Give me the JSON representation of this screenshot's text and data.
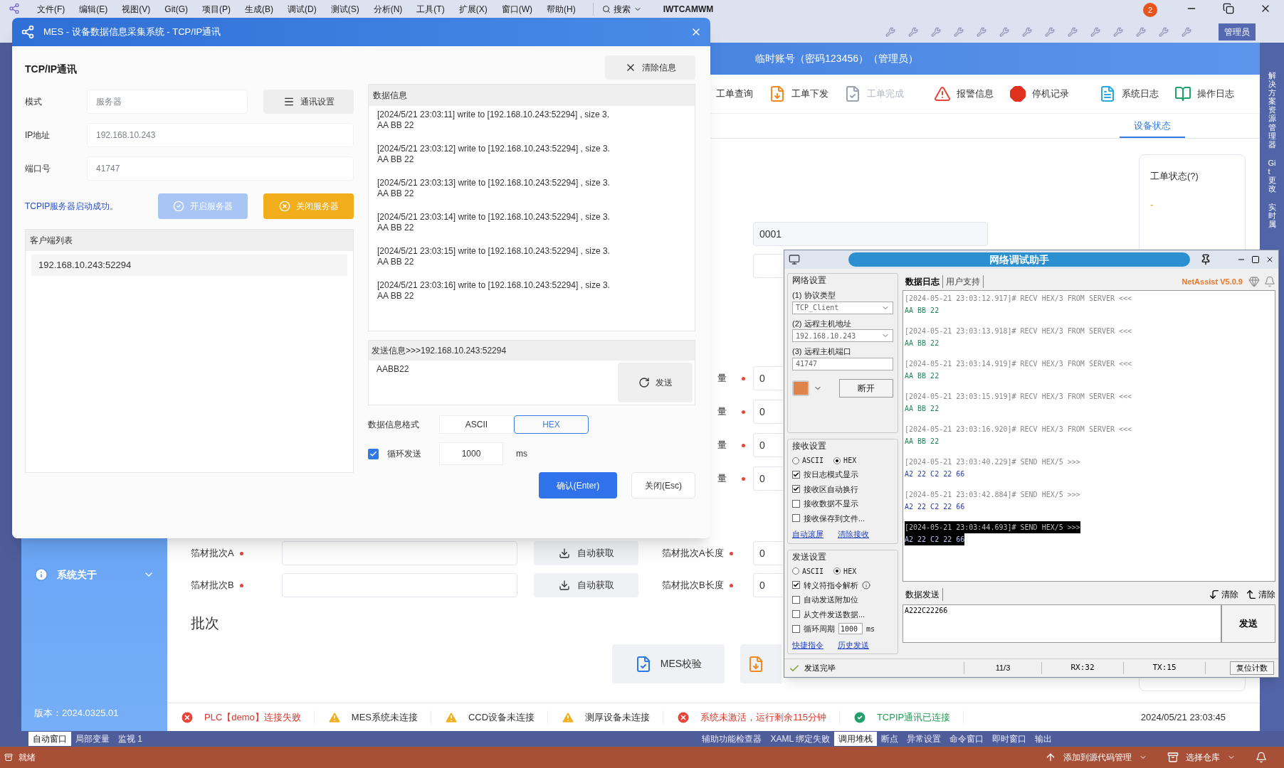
{
  "ide": {
    "menu": [
      "文件(F)",
      "编辑(E)",
      "视图(V)",
      "Git(G)",
      "项目(P)",
      "生成(B)",
      "调试(D)",
      "测试(S)",
      "分析(N)",
      "工具(T)",
      "扩展(X)",
      "窗口(W)",
      "帮助(H)"
    ],
    "search": "搜索",
    "project": "IWTCAMWM",
    "notifications": "2",
    "account": "管理员",
    "side_tabs": [
      "解决方案资源管理器",
      "Git 更改",
      "实时属"
    ],
    "bottom_tabs_left": [
      {
        "label": "自动窗口",
        "selected": true
      },
      {
        "label": "局部变量",
        "selected": false
      },
      {
        "label": "监视 1",
        "selected": false
      }
    ],
    "bottom_tabs_right": [
      {
        "label": "辅助功能检查器",
        "selected": false
      },
      {
        "label": "XAML 绑定失败",
        "selected": false
      },
      {
        "label": "调用堆栈",
        "selected": true
      },
      {
        "label": "断点",
        "selected": false
      },
      {
        "label": "异常设置",
        "selected": false
      },
      {
        "label": "命令窗口",
        "selected": false
      },
      {
        "label": "即时窗口",
        "selected": false
      },
      {
        "label": "输出",
        "selected": false
      }
    ],
    "status": "就绪",
    "status_right": [
      "添加到源代码管理",
      "选择仓库"
    ]
  },
  "app": {
    "user": "临时账号（密码123456）（管理员）",
    "toolbar": [
      {
        "label": "工单查询",
        "kind": "query",
        "disabled": false
      },
      {
        "label": "工单下发",
        "kind": "dispatch",
        "disabled": false
      },
      {
        "label": "工单完成",
        "kind": "complete",
        "disabled": true
      },
      {
        "label": "报警信息",
        "kind": "alarm",
        "disabled": false
      },
      {
        "label": "停机记录",
        "kind": "stop",
        "disabled": false
      },
      {
        "label": "系统日志",
        "kind": "syslog",
        "disabled": false
      },
      {
        "label": "操作日志",
        "kind": "oplog",
        "disabled": false
      }
    ],
    "tabs": [
      {
        "label": "设备状态",
        "selected": true
      }
    ],
    "sidebar": [
      {
        "label": "系统关于"
      }
    ],
    "version": "版本：2024.0325.01",
    "order_value": "0001",
    "measure_rows": [
      {
        "label": "量",
        "value": "0"
      },
      {
        "label": "量",
        "value": "0"
      },
      {
        "label": "量",
        "value": "0"
      },
      {
        "label": "量",
        "value": "0"
      }
    ],
    "batch_rows": [
      {
        "label": "箔材批次A",
        "button": "自动获取",
        "length_label": "箔材批次A长度",
        "length": "0"
      },
      {
        "label": "箔材批次B",
        "button": "自动获取",
        "length_label": "箔材批次B长度",
        "length": "0"
      }
    ],
    "section_title": "批次",
    "verify_button": "MES校验",
    "status_card": {
      "title": "工单状态(?)",
      "value": "-"
    },
    "status_bar": [
      {
        "kind": "error",
        "text": "PLC【demo】连接失败"
      },
      {
        "kind": "warning",
        "text": "MES系统未连接"
      },
      {
        "kind": "warning",
        "text": "CCD设备未连接"
      },
      {
        "kind": "warning",
        "text": "测厚设备未连接"
      },
      {
        "kind": "error",
        "text": "系统未激活，运行剩余115分钟"
      },
      {
        "kind": "ok",
        "text": "TCPIP通讯已连接"
      }
    ],
    "datetime": "2024/05/21 23:03:45"
  },
  "dialog": {
    "title": "MES - 设备数据信息采集系统 - TCP/IP通讯",
    "heading": "TCP/IP通讯",
    "clear_button": "清除信息",
    "fields": [
      {
        "label": "模式",
        "value": "服务器"
      },
      {
        "label": "IP地址",
        "value": "192.168.10.243"
      },
      {
        "label": "端口号",
        "value": "41747"
      }
    ],
    "settings_button": "通讯设置",
    "message": "TCPIP服务器启动成功。",
    "start_button": {
      "label": "开启服务器",
      "disabled": true
    },
    "stop_button": {
      "label": "关闭服务器",
      "disabled": false
    },
    "client_title": "客户端列表",
    "clients": [
      "192.168.10.243:52294"
    ],
    "data_title": "数据信息",
    "log": [
      {
        "line": "[2024/5/21 23:03:11] write to [192.168.10.243:52294] , size 3.",
        "data": "AA BB 22"
      },
      {
        "line": "[2024/5/21 23:03:12] write to [192.168.10.243:52294] , size 3.",
        "data": "AA BB 22"
      },
      {
        "line": "[2024/5/21 23:03:13] write to [192.168.10.243:52294] , size 3.",
        "data": "AA BB 22"
      },
      {
        "line": "[2024/5/21 23:03:14] write to [192.168.10.243:52294] , size 3.",
        "data": "AA BB 22"
      },
      {
        "line": "[2024/5/21 23:03:15] write to [192.168.10.243:52294] , size 3.",
        "data": "AA BB 22"
      },
      {
        "line": "[2024/5/21 23:03:16] write to [192.168.10.243:52294] , size 3.",
        "data": "AA BB 22"
      }
    ],
    "send_title": "发送信息>>>192.168.10.243:52294",
    "send_value": "AABB22",
    "send_button": "发送",
    "format_label": "数据信息格式",
    "formats": [
      {
        "label": "ASCII",
        "selected": false
      },
      {
        "label": "HEX",
        "selected": true
      }
    ],
    "loop": {
      "label": "循环发送",
      "checked": true,
      "interval": "1000",
      "unit": "ms"
    },
    "confirm_button": "确认(Enter)",
    "close_button": "关闭(Esc)"
  },
  "netassist": {
    "title": "网络调试助手",
    "net_title": "网络设置",
    "protocol_label": "(1) 协议类型",
    "protocol": "TCP_Client",
    "host_label": "(2) 远程主机地址",
    "host": "192.168.10.243",
    "port_label": "(3) 远程主机端口",
    "port": "41747",
    "connect_button": "断开",
    "recv_title": "接收设置",
    "recv_modes": [
      {
        "label": "ASCII",
        "selected": false
      },
      {
        "label": "HEX",
        "selected": true
      }
    ],
    "recv_options": [
      {
        "label": "按日志模式显示",
        "checked": true
      },
      {
        "label": "接收区自动换行",
        "checked": true
      },
      {
        "label": "接收数据不显示",
        "checked": false
      },
      {
        "label": "接收保存到文件...",
        "checked": false
      }
    ],
    "recv_links": [
      "自动滚屏",
      "清除接收"
    ],
    "send_title": "发送设置",
    "send_modes": [
      {
        "label": "ASCII",
        "selected": false
      },
      {
        "label": "HEX",
        "selected": true
      }
    ],
    "send_options": [
      {
        "kind": "plain",
        "label": "转义符指令解析",
        "checked": true,
        "info": true
      },
      {
        "kind": "plain",
        "label": "自动发送附加位",
        "checked": false,
        "info": false
      },
      {
        "kind": "plain",
        "label": "从文件发送数据...",
        "checked": false,
        "info": false
      },
      {
        "kind": "interval",
        "label": "循环周期",
        "checked": false,
        "info": false,
        "value": "1000",
        "unit": "ms"
      }
    ],
    "send_links": [
      "快捷指令",
      "历史发送"
    ],
    "tabs": [
      {
        "label": "数据日志",
        "selected": true
      },
      {
        "label": "用户支持",
        "selected": false
      }
    ],
    "version": "NetAssist V5.0.9",
    "log": [
      {
        "kind": "recv",
        "header": "[2024-05-21 23:03:12.917]# RECV HEX/3 FROM SERVER <<<",
        "data": "AA BB 22",
        "selected": false
      },
      {
        "kind": "recv",
        "header": "[2024-05-21 23:03:13.918]# RECV HEX/3 FROM SERVER <<<",
        "data": "AA BB 22",
        "selected": false
      },
      {
        "kind": "recv",
        "header": "[2024-05-21 23:03:14.919]# RECV HEX/3 FROM SERVER <<<",
        "data": "AA BB 22",
        "selected": false
      },
      {
        "kind": "recv",
        "header": "[2024-05-21 23:03:15.919]# RECV HEX/3 FROM SERVER <<<",
        "data": "AA BB 22",
        "selected": false
      },
      {
        "kind": "recv",
        "header": "[2024-05-21 23:03:16.920]# RECV HEX/3 FROM SERVER <<<",
        "data": "AA BB 22",
        "selected": false
      },
      {
        "kind": "send",
        "header": "[2024-05-21 23:03:40.229]# SEND HEX/5 >>>",
        "data": "A2 22 C2 22 66",
        "selected": false
      },
      {
        "kind": "send",
        "header": "[2024-05-21 23:03:42.884]# SEND HEX/5 >>>",
        "data": "A2 22 C2 22 66",
        "selected": false
      },
      {
        "kind": "send",
        "header": "[2024-05-21 23:03:44.693]# SEND HEX/5 >>>",
        "data": "A2 22 C2 22 66",
        "selected": true
      }
    ],
    "send_tab": "数据发送",
    "clear_buttons": [
      "清除",
      "清除"
    ],
    "send_text": "A222C22266",
    "send_button": "发送",
    "status": "发送完毕",
    "counter": "11/3",
    "rx": "RX:32",
    "tx": "TX:15",
    "reset_button": "复位计数"
  }
}
